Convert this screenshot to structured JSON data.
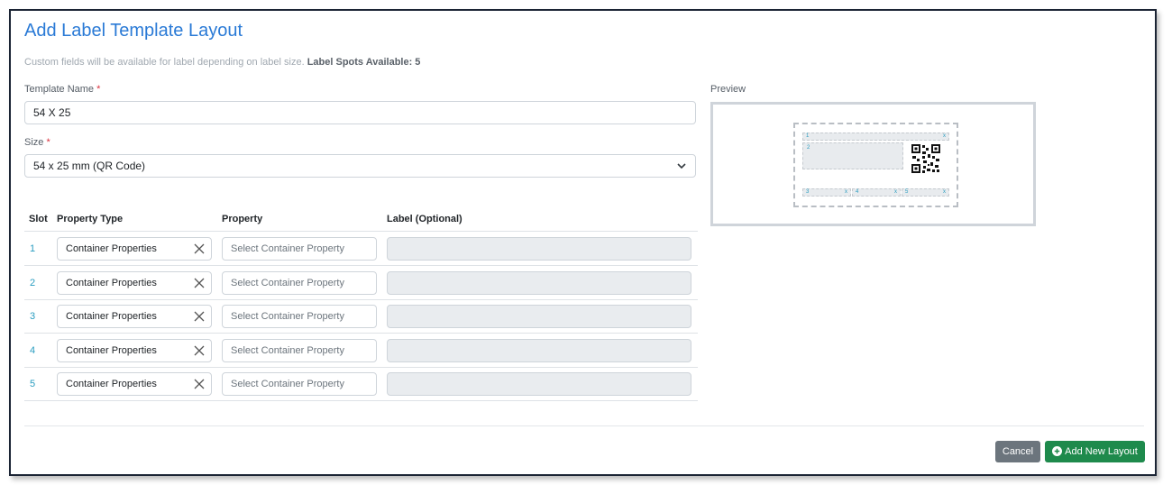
{
  "page": {
    "title": "Add Label Template Layout",
    "subtitle_text": "Custom fields will be available for label depending on label size.",
    "subtitle_bold": "Label Spots Available: 5"
  },
  "form": {
    "template_name_label": "Template Name",
    "template_name_value": "54 X 25",
    "size_label": "Size",
    "size_value": "54 x 25 mm (QR Code)",
    "required_marker": "*"
  },
  "table": {
    "headers": [
      "Slot",
      "Property Type",
      "Property",
      "Label (Optional)"
    ],
    "rows": [
      {
        "slot": "1",
        "property_type": "Container Properties",
        "property_placeholder": "Select Container Property"
      },
      {
        "slot": "2",
        "property_type": "Container Properties",
        "property_placeholder": "Select Container Property"
      },
      {
        "slot": "3",
        "property_type": "Container Properties",
        "property_placeholder": "Select Container Property"
      },
      {
        "slot": "4",
        "property_type": "Container Properties",
        "property_placeholder": "Select Container Property"
      },
      {
        "slot": "5",
        "property_type": "Container Properties",
        "property_placeholder": "Select Container Property"
      }
    ]
  },
  "preview": {
    "label": "Preview",
    "slots": [
      "1",
      "2",
      "3",
      "4",
      "5"
    ],
    "remove_marker": "x"
  },
  "footer": {
    "cancel_label": "Cancel",
    "add_label": "Add New Layout"
  },
  "colors": {
    "title": "#2a7ad6",
    "slot_number": "#2a9dc0",
    "cancel_button": "#6c757d",
    "add_button": "#1e8a4c",
    "required": "#d9333f"
  },
  "icons": {
    "select_arrow": "chevron-down-icon",
    "clear": "close-icon",
    "add": "plus-circle-icon",
    "qr": "qr-code-icon"
  }
}
